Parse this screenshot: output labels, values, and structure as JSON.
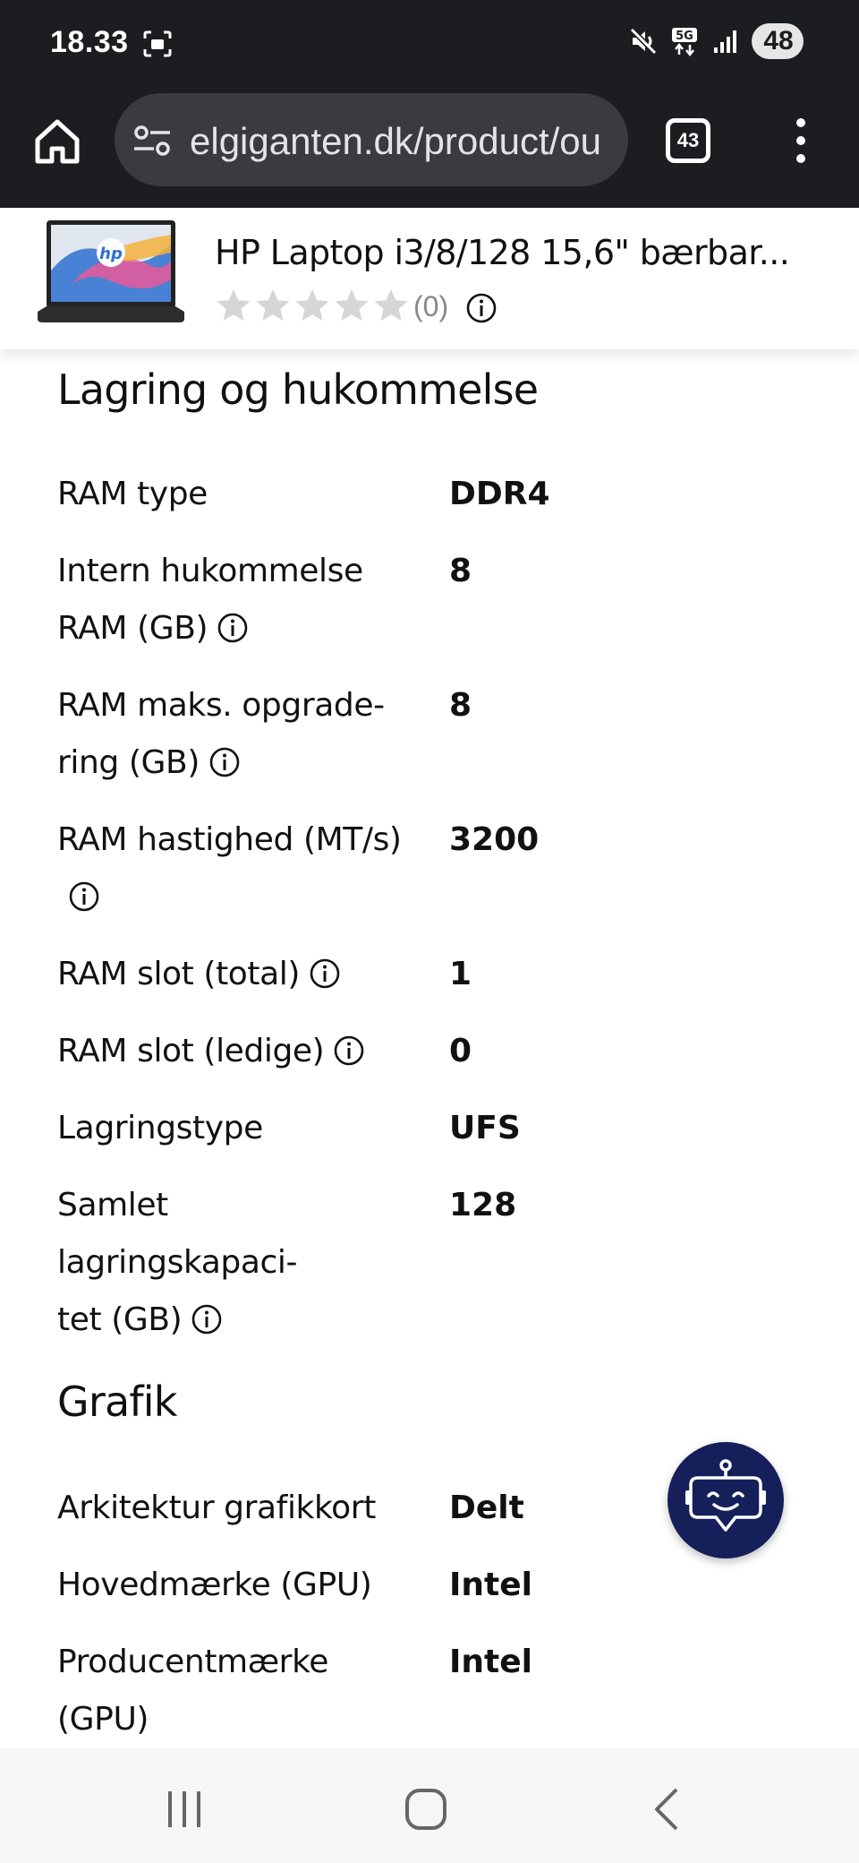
{
  "status_bar": {
    "time": "18.33",
    "network": "5G",
    "battery": "48"
  },
  "browser": {
    "url": "elgiganten.dk/product/ou",
    "tab_count": "43"
  },
  "product_header": {
    "title": "HP Laptop i3/8/128 15,6\" bærbar...",
    "rating_stars": 0,
    "rating_count": "(0)"
  },
  "sections": [
    {
      "title": "Lagring og hukommelse",
      "rows": [
        {
          "label_lines": [
            "RAM type"
          ],
          "value": "DDR4"
        },
        {
          "label_lines": [
            "Intern hukommelse",
            "RAM (GB)"
          ],
          "value": "8"
        },
        {
          "label_lines": [
            "RAM maks. opgrade-",
            "ring (GB)"
          ],
          "value": "8"
        },
        {
          "label_lines": [
            "RAM hastighed (MT/s)"
          ],
          "value": "3200"
        },
        {
          "label_lines": [
            "RAM slot (total)"
          ],
          "value": "1"
        },
        {
          "label_lines": [
            "RAM slot (ledige)"
          ],
          "value": "0"
        },
        {
          "label_lines": [
            "Lagringstype"
          ],
          "value": "UFS"
        },
        {
          "label_lines": [
            "Samlet lagringskapaci-",
            "tet (GB)"
          ],
          "value": "128"
        }
      ]
    },
    {
      "title": "Grafik",
      "rows": [
        {
          "label_lines": [
            "Arkitektur grafikkort"
          ],
          "value": "Delt"
        },
        {
          "label_lines": [
            "Hovedmærke (GPU)"
          ],
          "value": "Intel"
        },
        {
          "label_lines": [
            "Producentmærke",
            "(GPU)"
          ],
          "value": "Intel"
        }
      ]
    }
  ],
  "icons": {
    "home": "home-icon",
    "site_settings": "tune-icon",
    "menu": "more-vert-icon",
    "info": "info-icon",
    "star": "star-icon",
    "chatbot": "robot-chat-icon",
    "nav_recents": "recents-icon",
    "nav_home": "nav-home-icon",
    "nav_back": "back-icon"
  },
  "colors": {
    "browser_chrome": "#1c1d21",
    "url_pill": "#3a3b40",
    "fab": "#15205a",
    "star_empty": "#d6d6d6",
    "rating_text": "#888888"
  }
}
